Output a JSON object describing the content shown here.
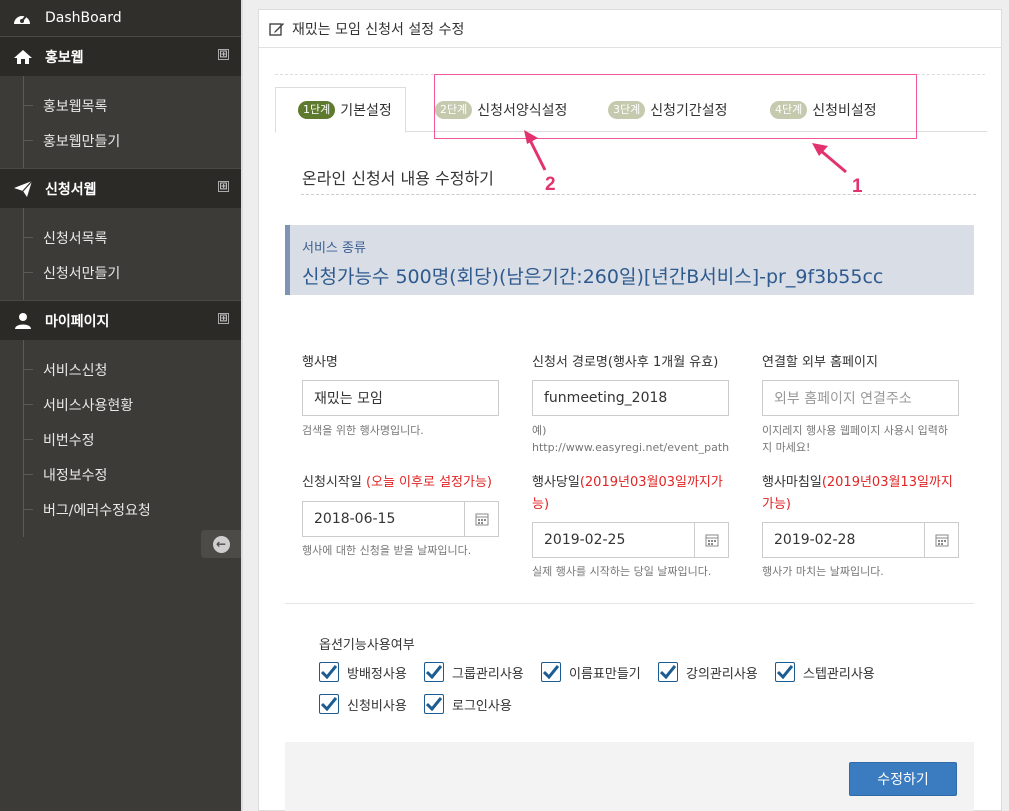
{
  "sidebar": {
    "dashboard": "DashBoard",
    "sections": [
      {
        "title": "홍보웹",
        "items": [
          "홍보웹목록",
          "홍보웹만들기"
        ]
      },
      {
        "title": "신청서웹",
        "items": [
          "신청서목록",
          "신청서만들기"
        ]
      },
      {
        "title": "마이페이지",
        "items": [
          "서비스신청",
          "서비스사용현황",
          "비번수정",
          "내정보수정",
          "버그/에러수정요청"
        ]
      }
    ],
    "plus": "⊞"
  },
  "panel": {
    "title": "재밌는 모임 신청서 설정 수정"
  },
  "tabs": [
    {
      "step": "1단계",
      "label": "기본설정"
    },
    {
      "step": "2단계",
      "label": "신청서양식설정"
    },
    {
      "step": "3단계",
      "label": "신청기간설정"
    },
    {
      "step": "4단계",
      "label": "신청비설정"
    }
  ],
  "annotations": {
    "n1": "1",
    "n2": "2",
    "highlight_color": "#f0589a"
  },
  "subtitle": "온라인 신청서 내용 수정하기",
  "service": {
    "label": "서비스 종류",
    "value": "신청가능수 500명(회당)(남은기간:260일)[년간B서비스]-pr_9f3b55cc"
  },
  "fields": {
    "event_name": {
      "label": "행사명",
      "value": "재밌는 모임",
      "help": "검색을 위한 행사명입니다."
    },
    "path": {
      "label": "신청서 경로명(행사후 1개월 유효)",
      "value": "funmeeting_2018",
      "help1": "예)",
      "help2": "http://www.easyregi.net/event_path"
    },
    "homepage": {
      "label": "연결할 외부 홈페이지",
      "placeholder": "외부 홈페이지 연결주소",
      "help1": "이지레지 행사용 웹페이지 사용시 입력하",
      "help2": "지 마세요!"
    },
    "start": {
      "label": "신청시작일 ",
      "note": "(오늘 이후로 설정가능)",
      "value": "2018-06-15",
      "help": "행사에 대한 신청을 받을 날짜입니다."
    },
    "event_day": {
      "label": "행사당일",
      "note1": "(2019년03월03일까지가",
      "note2": "능)",
      "value": "2019-02-25",
      "help": "실제 행사를 시작하는 당일 날짜입니다."
    },
    "end_day": {
      "label": "행사마침일",
      "note1": "(2019년03월13일까지",
      "note2": "가능)",
      "value": "2019-02-28",
      "help": "행사가 마치는 날짜입니다."
    }
  },
  "options": {
    "title": "옵션기능사용여부",
    "items": [
      "방배정사용",
      "그룹관리사용",
      "이름표만들기",
      "강의관리사용",
      "스텝관리사용",
      "신청비사용",
      "로그인사용"
    ]
  },
  "submit_label": "수정하기",
  "colors": {
    "sidebar_bg": "#3c3b37",
    "accent": "#3b7bbf",
    "service_text": "#2d5a8f",
    "red": "#e02424"
  }
}
